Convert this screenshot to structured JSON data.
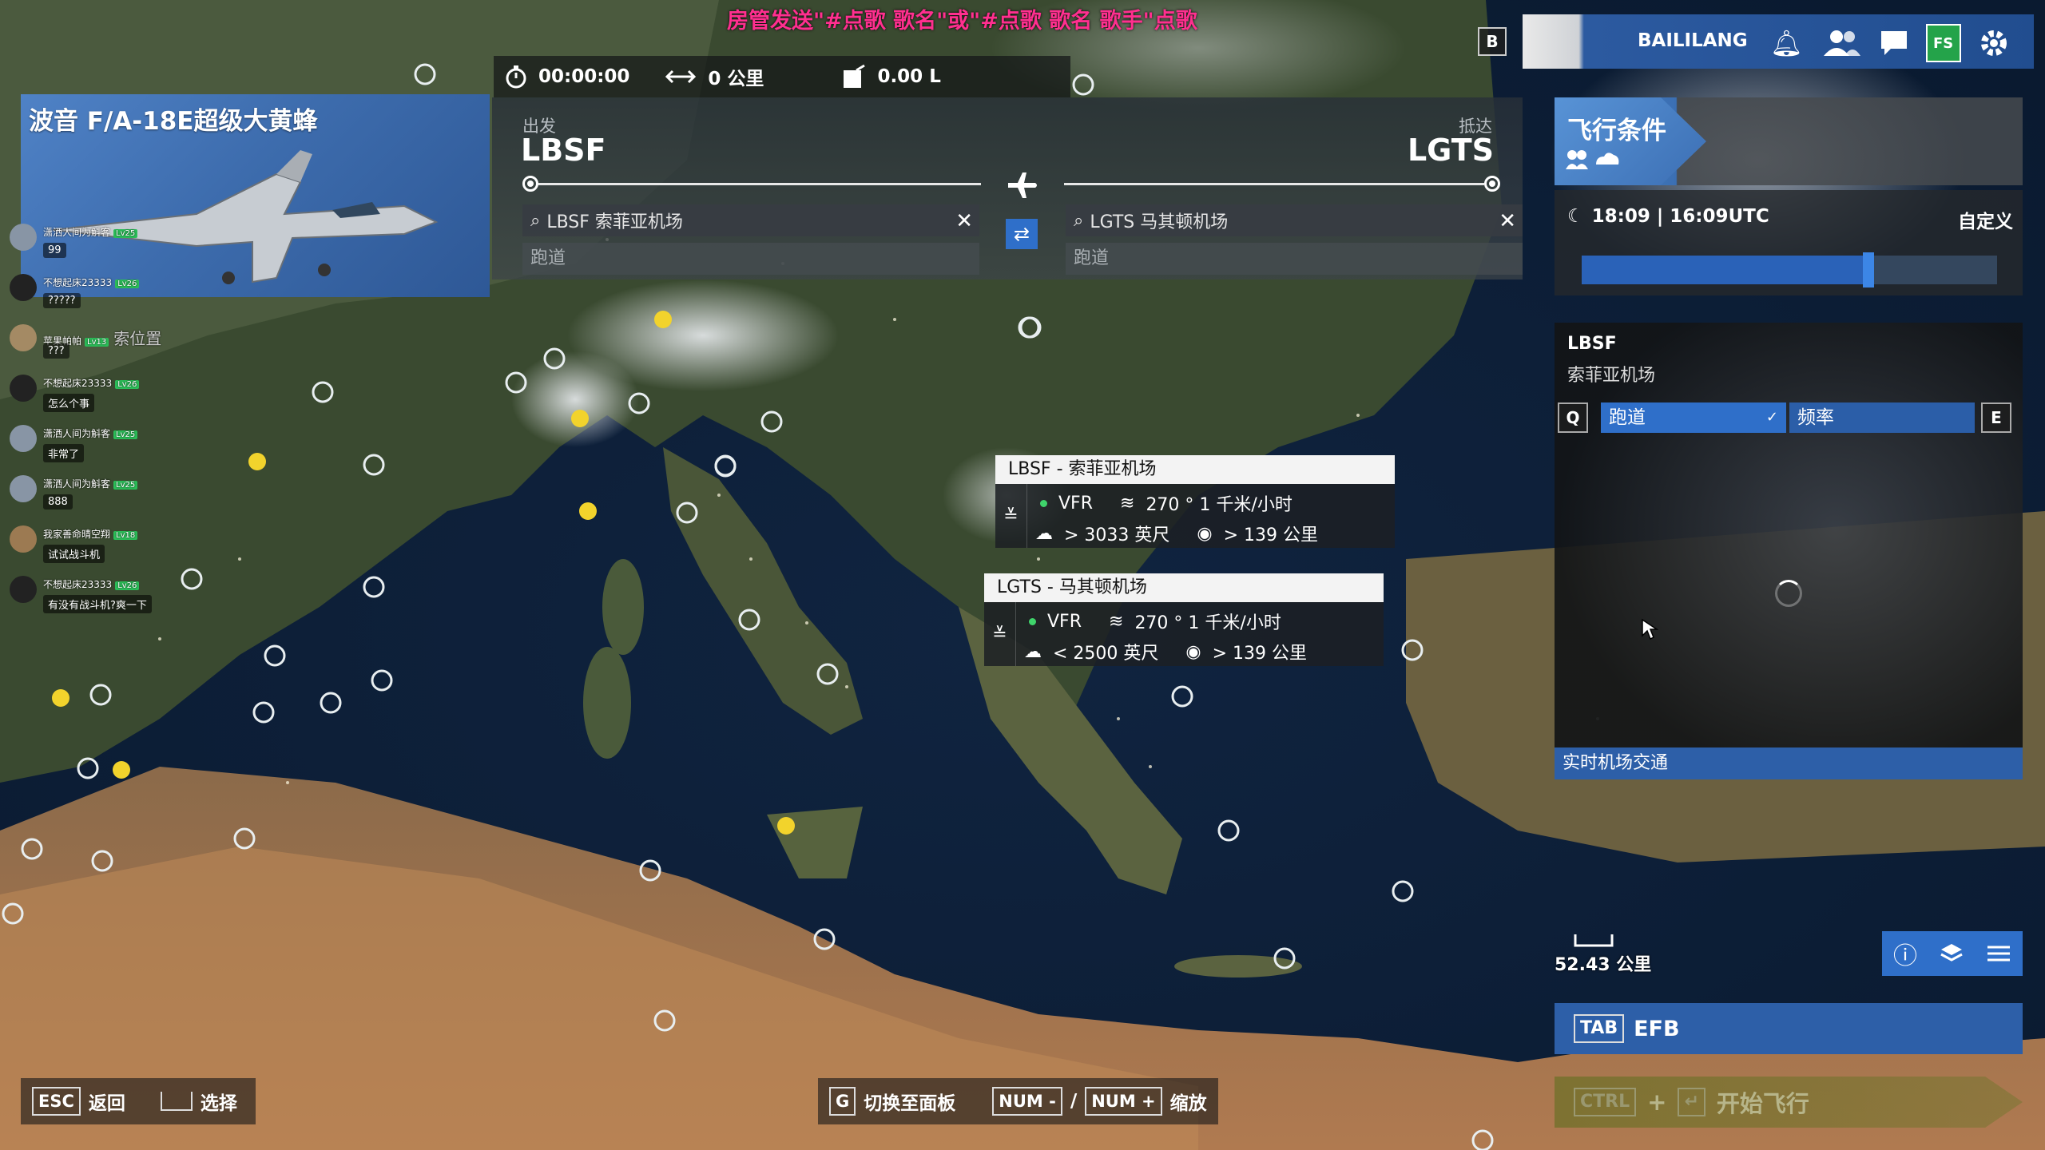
{
  "stream_overlay": "房管发送\"#点歌 歌名\"或\"#点歌 歌名 歌手\"点歌",
  "stats": {
    "time": "00:00:00",
    "distance": "0 公里",
    "fuel": "0.00 L"
  },
  "aircraft": {
    "title": "波音 F/A-18E超级大黄蜂"
  },
  "chat": [
    {
      "user": "潇洒人间为斛客",
      "level": "Lv25",
      "msg": "99"
    },
    {
      "user": "不想起床23333",
      "level": "Lv26",
      "msg": "?????"
    },
    {
      "user": "苹果帕帕",
      "level": "Lv13",
      "msg": "???"
    },
    {
      "user": "不想起床23333",
      "level": "Lv26",
      "msg": "怎么个事"
    },
    {
      "user": "潇洒人间为斛客",
      "level": "Lv25",
      "msg": "非常了"
    },
    {
      "user": "潇洒人间为斛客",
      "level": "Lv25",
      "msg": "888"
    },
    {
      "user": "我家善命晴空翔",
      "level": "Lv18",
      "msg": "试试战斗机"
    },
    {
      "user": "不想起床23333",
      "level": "Lv26",
      "msg": "有没有战斗机?爽一下"
    }
  ],
  "chat_overlay_text": "索位置",
  "route": {
    "departure_label": "出发",
    "departure_code": "LBSF",
    "departure_search": "LBSF 索菲亚机场",
    "departure_runway": "跑道",
    "arrival_label": "抵达",
    "arrival_code": "LGTS",
    "arrival_search": "LGTS 马其顿机场",
    "arrival_runway": "跑道"
  },
  "weather_popups": [
    {
      "title": "LBSF - 索菲亚机场",
      "rule": "VFR",
      "wind": "270 ° 1 千米/小时",
      "ceiling": "> 3033  英尺",
      "visibility": "> 139  公里"
    },
    {
      "title": "LGTS - 马其顿机场",
      "rule": "VFR",
      "wind": "270 ° 1 千米/小时",
      "ceiling": "< 2500  英尺",
      "visibility": "> 139  公里"
    }
  ],
  "flight_conditions": {
    "title": "飞行条件",
    "time": "18:09 | 16:09UTC",
    "custom_label": "自定义",
    "time_slider_fraction": 0.69
  },
  "airport_info": {
    "code": "LBSF",
    "name": "索菲亚机场",
    "key_left": "Q",
    "tab_runway": "跑道",
    "tab_frequency": "频率",
    "key_right": "E",
    "traffic_label": "实时机场交通"
  },
  "map": {
    "distance": "52.43  公里"
  },
  "efb": {
    "key": "TAB",
    "label": "EFB"
  },
  "start": {
    "key": "CTRL",
    "plus": "+",
    "label": "开始飞行"
  },
  "account": {
    "key": "B",
    "name": "BAILILANG",
    "fs_label": "FS"
  },
  "hints": {
    "esc_key": "ESC",
    "esc_label": "返回",
    "select_label": "选择",
    "g_key": "G",
    "g_label": "切换至面板",
    "num_minus": "NUM -",
    "slash": "/",
    "num_plus": "NUM +",
    "zoom_label": "缩放"
  },
  "colors": {
    "accent_blue": "#2d5fa8",
    "button_blue": "#2f6fc9",
    "stream_pink": "#ff2f8f",
    "vfr_green": "#3fd46b"
  }
}
